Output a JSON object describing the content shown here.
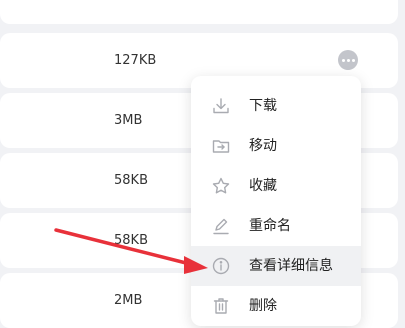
{
  "rows": [
    {
      "size": "127KB"
    },
    {
      "size": "3MB"
    },
    {
      "size": "58KB"
    },
    {
      "size": "58KB"
    },
    {
      "size": "2MB"
    }
  ],
  "menu": {
    "items": [
      {
        "label": "下载",
        "icon": "download-icon"
      },
      {
        "label": "移动",
        "icon": "move-to-folder-icon"
      },
      {
        "label": "收藏",
        "icon": "star-icon"
      },
      {
        "label": "重命名",
        "icon": "rename-pencil-icon"
      },
      {
        "label": "查看详细信息",
        "icon": "info-icon",
        "highlighted": true
      },
      {
        "label": "删除",
        "icon": "trash-icon"
      }
    ]
  },
  "colors": {
    "background": "#f1f2f5",
    "row": "#ffffff",
    "menu_highlight": "#f0f1f3",
    "annotation_arrow": "#e8313a",
    "icon_gray": "#a9abb1"
  }
}
